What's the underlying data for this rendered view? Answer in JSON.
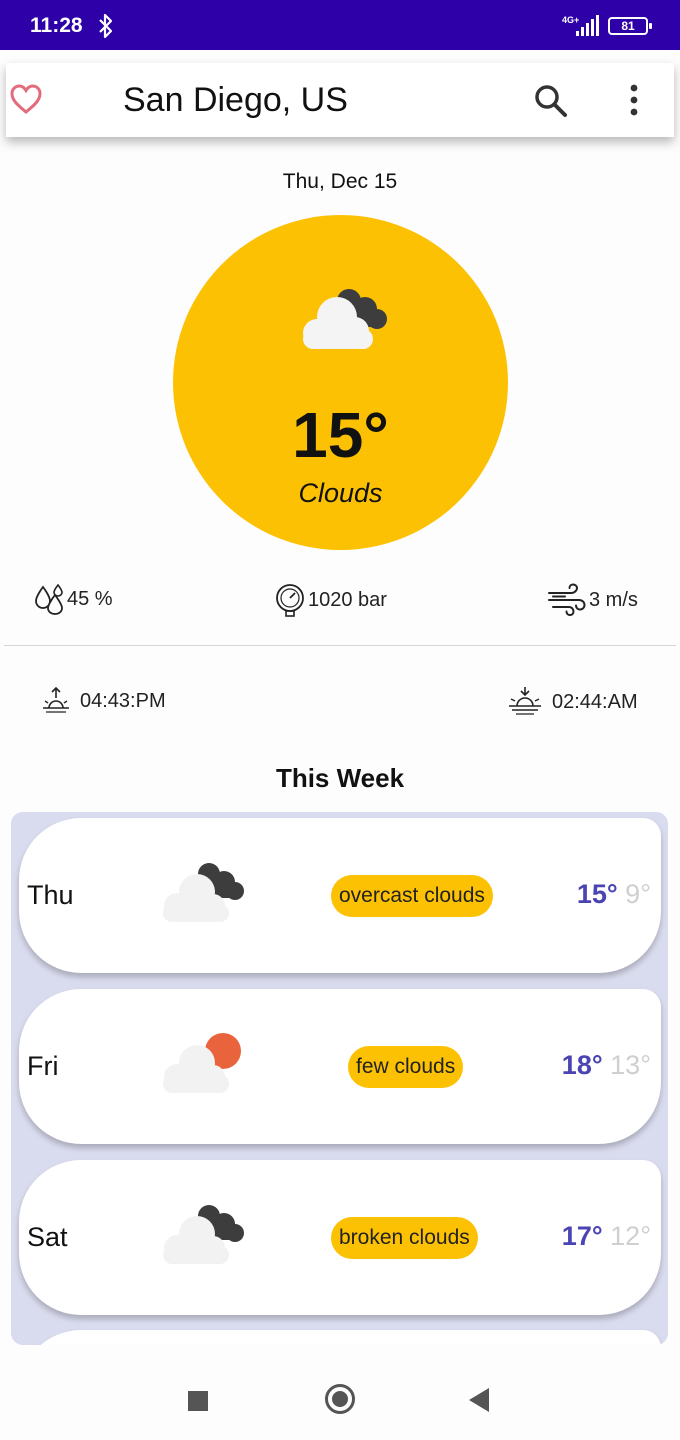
{
  "status_bar": {
    "time": "11:28",
    "network": "4G+",
    "battery": "81"
  },
  "app_bar": {
    "title": "San Diego, US",
    "favorite_icon": "heart-outline-icon",
    "search_icon": "search-icon",
    "menu_icon": "more-vert-icon"
  },
  "current": {
    "date": "Thu, Dec 15",
    "temperature": "15°",
    "condition": "Clouds",
    "icon": "cloud-icon",
    "circle_color": "#fdc104"
  },
  "stats": {
    "humidity": "45 %",
    "pressure": "1020 bar",
    "wind": "3 m/s"
  },
  "sun": {
    "sunrise": "04:43:PM",
    "sunset": "02:44:AM"
  },
  "week": {
    "title": "This Week",
    "days": [
      {
        "day": "Thu",
        "description": "overcast clouds",
        "high": "15°",
        "low": "9°",
        "icon": "dark-cloud-icon"
      },
      {
        "day": "Fri",
        "description": "few clouds",
        "high": "18°",
        "low": "13°",
        "icon": "sun-cloud-icon"
      },
      {
        "day": "Sat",
        "description": "broken clouds",
        "high": "17°",
        "low": "12°",
        "icon": "dark-cloud-icon"
      }
    ]
  },
  "colors": {
    "status_bar": "#2e00a8",
    "accent_yellow": "#fdc104",
    "high_temp": "#4b44b3",
    "low_temp": "#cfcfcf",
    "week_panel": "#d9dbee",
    "favorite": "#e46b7c"
  }
}
